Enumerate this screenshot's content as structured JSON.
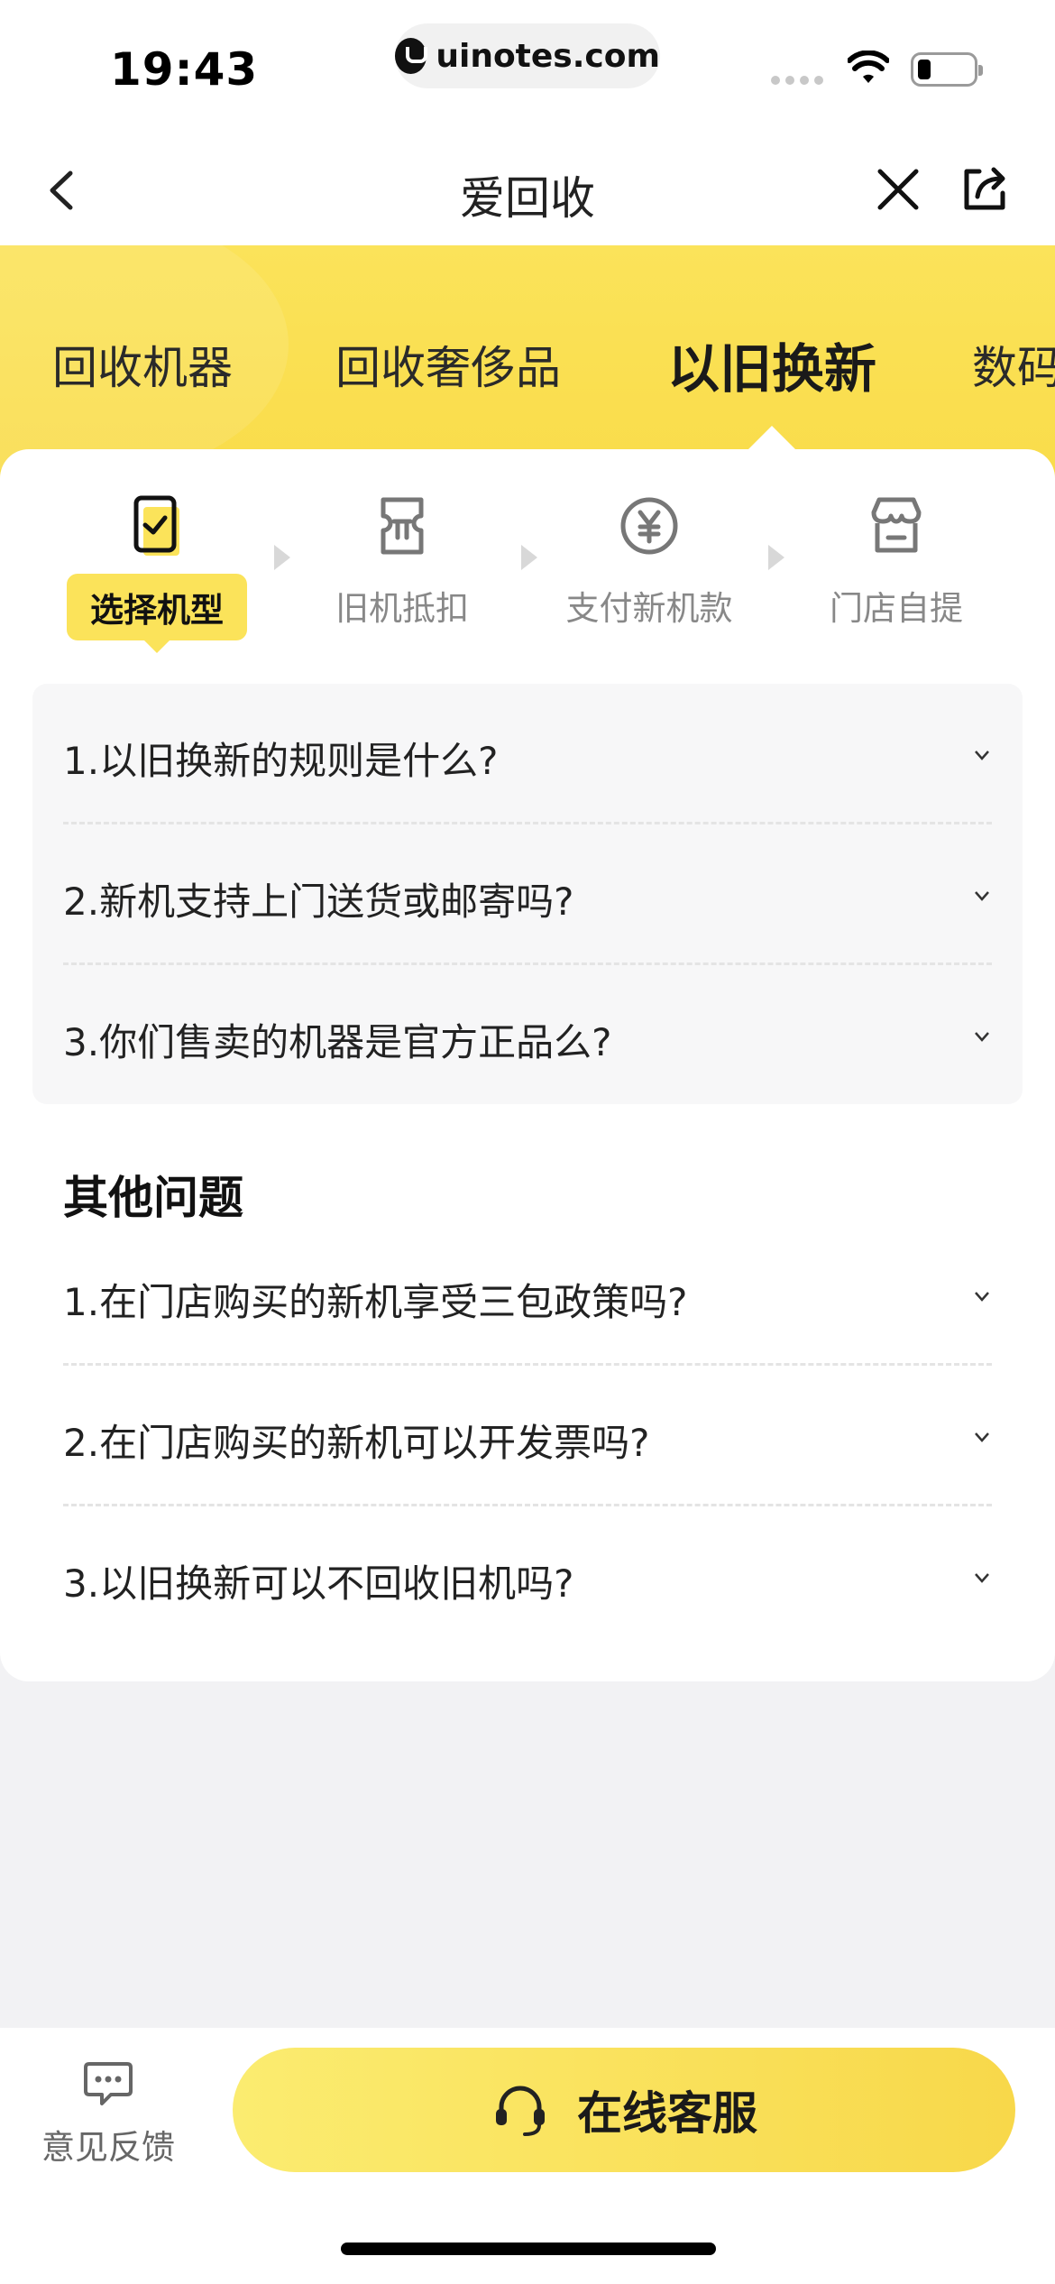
{
  "status_bar": {
    "time": "19:43",
    "url": "uinotes.com"
  },
  "nav": {
    "title": "爱回收"
  },
  "top_tabs": [
    {
      "label": "回收机器",
      "active": false
    },
    {
      "label": "回收奢侈品",
      "active": false
    },
    {
      "label": "以旧换新",
      "active": true
    },
    {
      "label": "数码",
      "active": false
    }
  ],
  "steps": [
    {
      "label": "选择机型",
      "icon": "phone-check-icon",
      "active": true
    },
    {
      "label": "旧机抵扣",
      "icon": "ticket-icon",
      "active": false
    },
    {
      "label": "支付新机款",
      "icon": "yuan-icon",
      "active": false
    },
    {
      "label": "门店自提",
      "icon": "store-icon",
      "active": false
    }
  ],
  "faq": [
    "1.以旧换新的规则是什么?",
    "2.新机支持上门送货或邮寄吗?",
    "3.你们售卖的机器是官方正品么?"
  ],
  "other": {
    "title": "其他问题",
    "items": [
      "1.在门店购买的新机享受三包政策吗?",
      "2.在门店购买的新机可以开发票吗?",
      "3.以旧换新可以不回收旧机吗?"
    ]
  },
  "bottom": {
    "feedback_label": "意见反馈",
    "service_label": "在线客服"
  },
  "colors": {
    "accent_yellow": "#fbe35a",
    "text_dark": "#1a1a1a",
    "text_muted": "#888888"
  }
}
